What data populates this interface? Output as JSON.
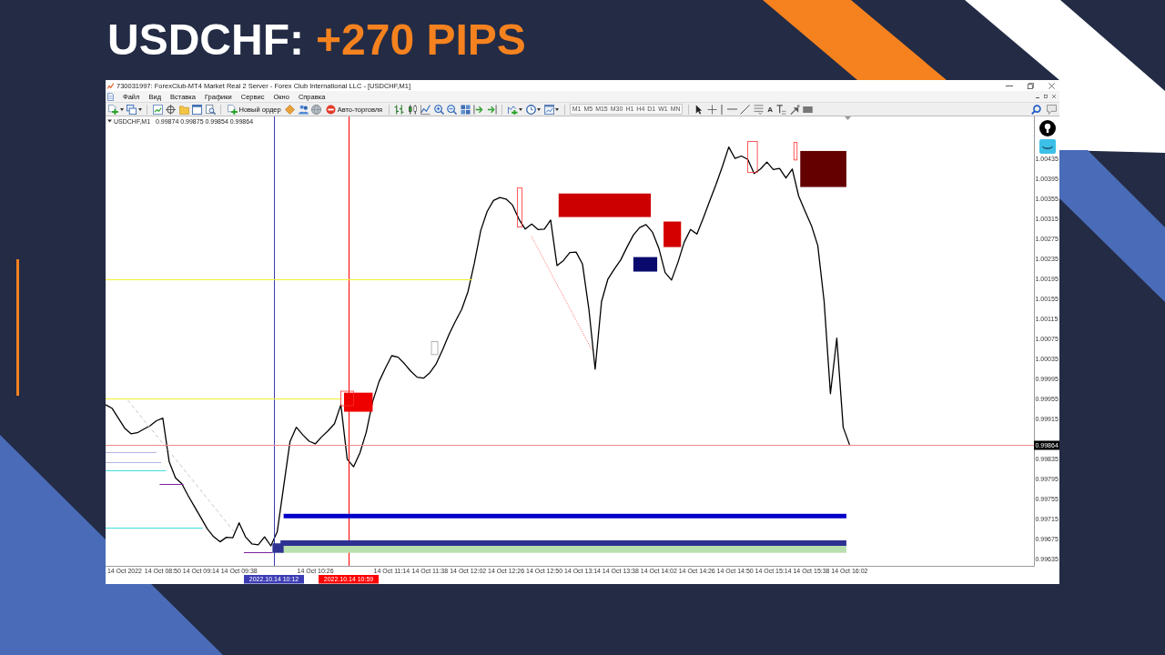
{
  "headline": {
    "symbol": "USDCHF:",
    "result": "+270 PIPS"
  },
  "window": {
    "title": "730031997: ForexClub-MT4 Market Real 2 Server - Forex Club International LLC - [USDCHF,M1]"
  },
  "menu": [
    "Файл",
    "Вид",
    "Вставка",
    "Графики",
    "Сервис",
    "Окно",
    "Справка"
  ],
  "toolbar": {
    "new_order": "Новый ордер",
    "auto_trading": "Авто-торговля",
    "timeframes": [
      "M1",
      "M5",
      "M15",
      "M30",
      "H1",
      "H4",
      "D1",
      "W1",
      "MN"
    ],
    "text_tool": "A"
  },
  "chart": {
    "symbol": "USDCHF,M1",
    "ohlc": "0.99874 0.99875 0.99854 0.99864",
    "chart_data": {
      "type": "line",
      "categories": [
        null,
        null,
        null,
        "14 Oct 2022",
        null,
        null,
        null,
        null,
        null,
        "14 Oct 08:50",
        null,
        null,
        null,
        null,
        null,
        "14 Oct 09:14",
        null,
        null,
        null,
        null,
        null,
        "14 Oct 09:38",
        null,
        null,
        null,
        null,
        null,
        null,
        null,
        null,
        null,
        null,
        null,
        "14 Oct 10:26",
        null,
        null,
        null,
        null,
        null,
        null,
        null,
        null,
        null,
        null,
        null,
        "14 Oct 11:14",
        null,
        null,
        null,
        null,
        null,
        "14 Oct 11:38",
        null,
        null,
        null,
        null,
        null,
        "14 Oct 12:02",
        null,
        null,
        null,
        null,
        null,
        "14 Oct 12:26",
        null,
        null,
        null,
        null,
        null,
        "14 Oct 12:50",
        null,
        null,
        null,
        null,
        null,
        "14 Oct 13:14",
        null,
        null,
        null,
        null,
        null,
        "14 Oct 13:38",
        null,
        null,
        null,
        null,
        null,
        "14 Oct 14:02",
        null,
        null,
        null,
        null,
        null,
        "14 Oct 14:26",
        null,
        null,
        null,
        null,
        null,
        "14 Oct 14:50",
        null,
        null,
        null,
        null,
        null,
        "14 Oct 15:14",
        null,
        null,
        null,
        null,
        null,
        "14 Oct 15:38",
        null,
        null,
        null,
        null,
        null,
        "14 Oct 16:02",
        null,
        null,
        null,
        null,
        null,
        null,
        null,
        null,
        null,
        null,
        null,
        null,
        null,
        null,
        null,
        null,
        null,
        null,
        null,
        null,
        null,
        null,
        null,
        null,
        null,
        null,
        null,
        null,
        null
      ],
      "series": [
        {
          "color": "#000000",
          "values": [
            0.99944,
            0.99937,
            0.99917,
            0.99897,
            0.99886,
            0.99888,
            0.99895,
            0.99902,
            0.99912,
            0.99917,
            0.9983,
            0.99798,
            0.99786,
            0.99762,
            0.9974,
            0.99718,
            0.99696,
            0.9968,
            0.9967,
            0.99679,
            0.99678,
            0.99708,
            0.9968,
            0.99666,
            0.99664,
            0.9968,
            0.99662,
            0.9969,
            0.9978,
            0.9987,
            0.99899,
            0.99884,
            0.99871,
            0.99866,
            0.9988,
            0.99892,
            0.99906,
            0.99944,
            0.99835,
            0.9982,
            0.99848,
            0.99889,
            0.9995,
            0.9999,
            1.00017,
            1.00042,
            1.00039,
            1.00026,
            1.00011,
            0.99999,
            0.99997,
            1.00008,
            1.00026,
            1.00054,
            1.00084,
            1.0011,
            1.00134,
            1.0017,
            1.00227,
            1.00292,
            1.0033,
            1.00352,
            1.00358,
            1.00355,
            1.00343,
            1.00315,
            1.00295,
            1.00305,
            1.00294,
            1.00295,
            1.00313,
            1.00222,
            1.00232,
            1.00248,
            1.00249,
            1.00225,
            1.00135,
            1.00015,
            1.0015,
            1.00195,
            1.00215,
            1.00233,
            1.00259,
            1.00283,
            1.00298,
            1.00304,
            1.00289,
            1.00257,
            1.00208,
            1.00193,
            1.00228,
            1.00269,
            1.00294,
            1.00285,
            1.00317,
            1.00351,
            1.00384,
            1.0042,
            1.00459,
            1.00436,
            1.00441,
            1.00434,
            1.00406,
            1.00415,
            1.00429,
            1.00414,
            1.00416,
            1.00397,
            1.00415,
            1.00361,
            1.00331,
            1.00302,
            1.00262,
            1.0015,
            0.99966,
            1.00077,
            0.99899,
            0.99864,
            null,
            null,
            null,
            null,
            null,
            null,
            null,
            null,
            null,
            null,
            null,
            null,
            null,
            null,
            null,
            null,
            null,
            null,
            null,
            null,
            null,
            null,
            null,
            null,
            null,
            null,
            null,
            null,
            null
          ]
        }
      ],
      "ylim": [
        0.99622,
        1.0052
      ],
      "yticks": [
        1.00435,
        1.00395,
        1.00355,
        1.00315,
        1.00275,
        1.00235,
        1.00195,
        1.00155,
        1.00115,
        1.00075,
        1.00035,
        0.99995,
        0.99955,
        0.99915,
        0.99835,
        0.99795,
        0.99755,
        0.99715,
        0.99675,
        0.99635
      ]
    },
    "time_markers": [
      {
        "label": "2022.10.14 10:12",
        "color": "#3c3cb4"
      },
      {
        "label": "2022.10.14 10:59",
        "color": "#ff0000"
      }
    ],
    "price_label": "0.99864"
  }
}
